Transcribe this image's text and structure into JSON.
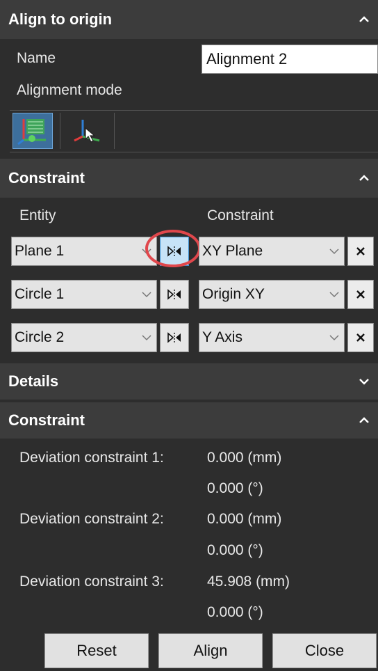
{
  "panel": {
    "title": "Align to origin",
    "name_label": "Name",
    "name_value": "Alignment 2",
    "mode_label": "Alignment mode"
  },
  "constraint_section": {
    "title": "Constraint",
    "entity_header": "Entity",
    "constraint_header": "Constraint",
    "rows": [
      {
        "entity": "Plane 1",
        "constraint": "XY Plane",
        "flip_active": true
      },
      {
        "entity": "Circle 1",
        "constraint": "Origin XY",
        "flip_active": false
      },
      {
        "entity": "Circle 2",
        "constraint": "Y Axis",
        "flip_active": false
      }
    ]
  },
  "details": {
    "title": "Details"
  },
  "deviation_section": {
    "title": "Constraint",
    "items": [
      {
        "label": "Deviation constraint 1:",
        "distance": "0.000 (mm)",
        "angle": "0.000 (°)"
      },
      {
        "label": "Deviation constraint 2:",
        "distance": "0.000 (mm)",
        "angle": "0.000 (°)"
      },
      {
        "label": "Deviation constraint 3:",
        "distance": "45.908 (mm)",
        "angle": "0.000 (°)"
      }
    ]
  },
  "buttons": {
    "reset": "Reset",
    "align": "Align",
    "close": "Close"
  },
  "colors": {
    "panel_bg": "#2d2d2d",
    "header_bg": "#3c3c3c",
    "highlight_ring": "#e0474c",
    "active_blue": "#3b8fd1"
  },
  "icons": [
    "chevron-up-icon",
    "chevron-down-icon",
    "flip-icon",
    "delete-x-icon",
    "align-3d-mode-icon",
    "align-pointer-mode-icon",
    "dropdown-arrow-icon"
  ]
}
